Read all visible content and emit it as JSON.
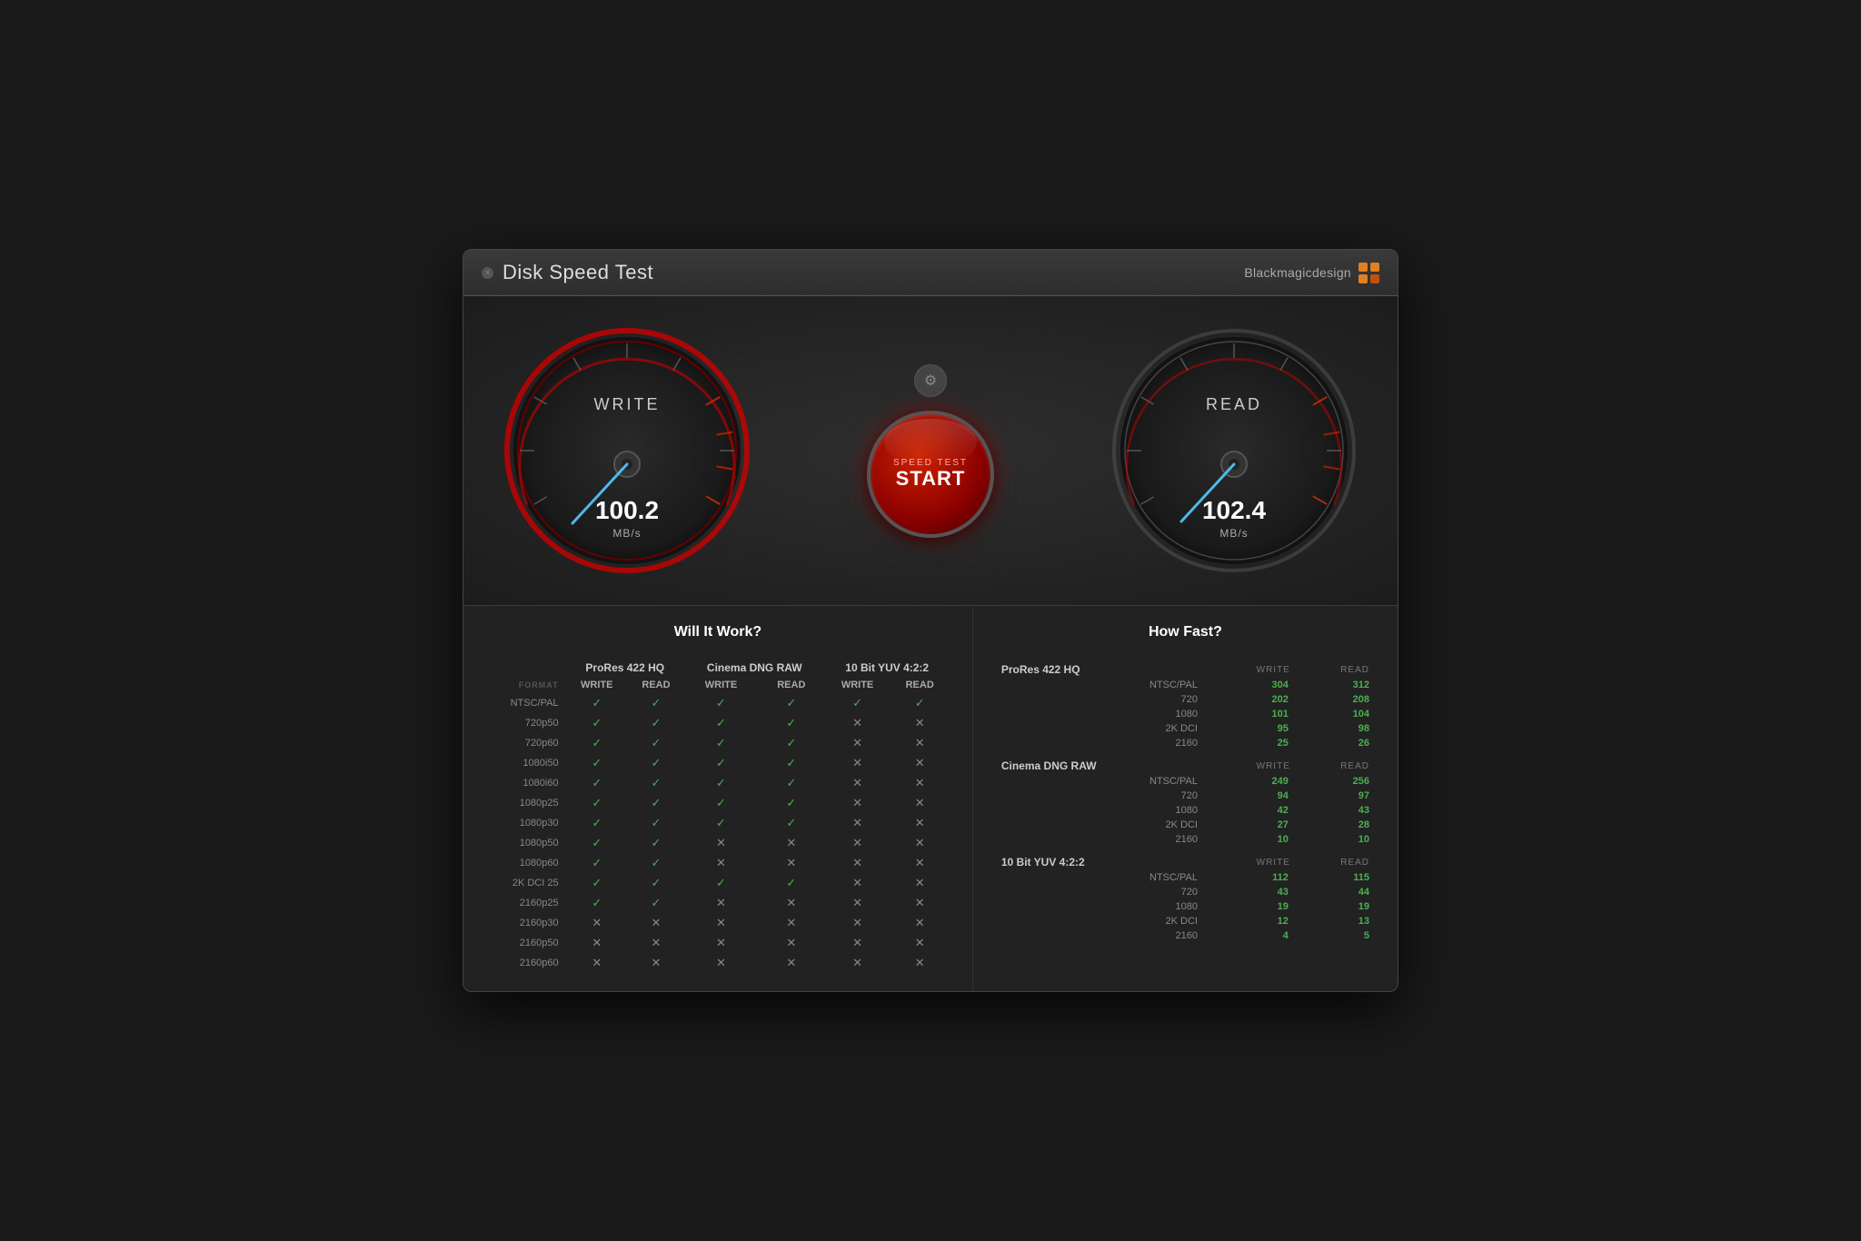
{
  "window": {
    "title": "Disk Speed Test",
    "brand": "Blackmagicdesign",
    "close_label": "×"
  },
  "gauges": {
    "write": {
      "label": "WRITE",
      "value": "100.2",
      "unit": "MB/s",
      "needle_angle": -20
    },
    "read": {
      "label": "READ",
      "value": "102.4",
      "unit": "MB/s",
      "needle_angle": -18
    }
  },
  "start_button": {
    "sub_label": "SPEED TEST",
    "main_label": "START"
  },
  "settings_icon": "⚙",
  "will_it_work": {
    "title": "Will It Work?",
    "col_groups": [
      "ProRes 422 HQ",
      "Cinema DNG RAW",
      "10 Bit YUV 4:2:2"
    ],
    "col_sub": [
      "WRITE",
      "READ",
      "WRITE",
      "READ",
      "WRITE",
      "READ"
    ],
    "format_label": "FORMAT",
    "rows": [
      {
        "format": "NTSC/PAL",
        "vals": [
          true,
          true,
          true,
          true,
          true,
          true
        ]
      },
      {
        "format": "720p50",
        "vals": [
          true,
          true,
          true,
          true,
          false,
          false
        ]
      },
      {
        "format": "720p60",
        "vals": [
          true,
          true,
          true,
          true,
          false,
          false
        ]
      },
      {
        "format": "1080i50",
        "vals": [
          true,
          true,
          true,
          true,
          false,
          false
        ]
      },
      {
        "format": "1080i60",
        "vals": [
          true,
          true,
          true,
          true,
          false,
          false
        ]
      },
      {
        "format": "1080p25",
        "vals": [
          true,
          true,
          true,
          true,
          false,
          false
        ]
      },
      {
        "format": "1080p30",
        "vals": [
          true,
          true,
          true,
          true,
          false,
          false
        ]
      },
      {
        "format": "1080p50",
        "vals": [
          true,
          true,
          false,
          false,
          false,
          false
        ]
      },
      {
        "format": "1080p60",
        "vals": [
          true,
          true,
          false,
          false,
          false,
          false
        ]
      },
      {
        "format": "2K DCI 25",
        "vals": [
          true,
          true,
          true,
          true,
          false,
          false
        ]
      },
      {
        "format": "2160p25",
        "vals": [
          true,
          true,
          false,
          false,
          false,
          false
        ]
      },
      {
        "format": "2160p30",
        "vals": [
          false,
          false,
          false,
          false,
          false,
          false
        ]
      },
      {
        "format": "2160p50",
        "vals": [
          false,
          false,
          false,
          false,
          false,
          false
        ]
      },
      {
        "format": "2160p60",
        "vals": [
          false,
          false,
          false,
          false,
          false,
          false
        ]
      }
    ]
  },
  "how_fast": {
    "title": "How Fast?",
    "groups": [
      {
        "name": "ProRes 422 HQ",
        "rows": [
          {
            "label": "NTSC/PAL",
            "write": "304",
            "read": "312"
          },
          {
            "label": "720",
            "write": "202",
            "read": "208"
          },
          {
            "label": "1080",
            "write": "101",
            "read": "104"
          },
          {
            "label": "2K DCI",
            "write": "95",
            "read": "98"
          },
          {
            "label": "2160",
            "write": "25",
            "read": "26"
          }
        ]
      },
      {
        "name": "Cinema DNG RAW",
        "rows": [
          {
            "label": "NTSC/PAL",
            "write": "249",
            "read": "256"
          },
          {
            "label": "720",
            "write": "94",
            "read": "97"
          },
          {
            "label": "1080",
            "write": "42",
            "read": "43"
          },
          {
            "label": "2K DCI",
            "write": "27",
            "read": "28"
          },
          {
            "label": "2160",
            "write": "10",
            "read": "10"
          }
        ]
      },
      {
        "name": "10 Bit YUV 4:2:2",
        "rows": [
          {
            "label": "NTSC/PAL",
            "write": "112",
            "read": "115"
          },
          {
            "label": "720",
            "write": "43",
            "read": "44"
          },
          {
            "label": "1080",
            "write": "19",
            "read": "19"
          },
          {
            "label": "2K DCI",
            "write": "12",
            "read": "13"
          },
          {
            "label": "2160",
            "write": "4",
            "read": "5"
          }
        ]
      }
    ],
    "col_write": "WRITE",
    "col_read": "READ"
  },
  "brand_dots": [
    {
      "color": "#e08020"
    },
    {
      "color": "#e08020"
    },
    {
      "color": "#e08020"
    },
    {
      "color": "#c05010"
    }
  ]
}
